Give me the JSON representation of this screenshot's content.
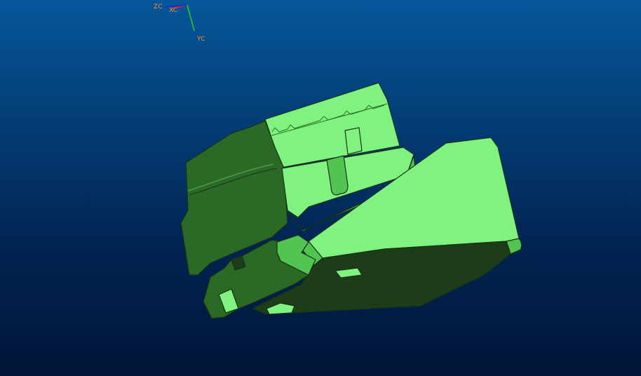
{
  "viewport": {
    "background_top": "#06579a",
    "background_bottom": "#011539"
  },
  "triad": {
    "zc_label": "ZC",
    "xc_label": "XC",
    "yc_label": "YC",
    "x_axis_color": "#e02020",
    "y_axis_color": "#22cc22",
    "z_axis_color": "#2222dd",
    "label_color": "#ff8a3a"
  },
  "model": {
    "shade_light": "#7ff27f",
    "shade_mid": "#52c452",
    "shade_dark": "#2b6a26",
    "shade_deep": "#1c3d17",
    "edge": "#163316"
  }
}
